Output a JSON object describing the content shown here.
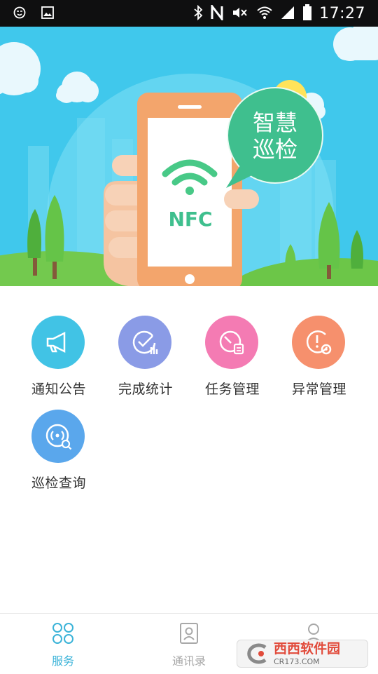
{
  "status_bar": {
    "time": "17:27",
    "icons": [
      "emoji-icon",
      "image-icon",
      "bluetooth-icon",
      "nfc-icon",
      "mute-icon",
      "wifi-icon",
      "signal-icon",
      "battery-icon"
    ]
  },
  "banner": {
    "nfc_text": "NFC",
    "bubble_line1": "智慧",
    "bubble_line2": "巡检",
    "colors": {
      "sky": "#3fc6ea",
      "phone": "#f3a56c",
      "bubble": "#3fbf8e",
      "wifi": "#48c987"
    }
  },
  "menu": {
    "items": [
      {
        "label": "通知公告",
        "icon": "megaphone-icon",
        "color": "#41c3e5"
      },
      {
        "label": "完成统计",
        "icon": "stats-check-icon",
        "color": "#8a9be6"
      },
      {
        "label": "任务管理",
        "icon": "task-icon",
        "color": "#f47bb3"
      },
      {
        "label": "异常管理",
        "icon": "alert-gear-icon",
        "color": "#f6906d"
      },
      {
        "label": "巡检查询",
        "icon": "nfc-search-icon",
        "color": "#5aa7ec"
      }
    ]
  },
  "tabbar": {
    "tabs": [
      {
        "label": "服务",
        "icon": "grid-icon",
        "active": true
      },
      {
        "label": "通讯录",
        "icon": "contacts-icon",
        "active": false
      },
      {
        "label": "",
        "icon": "profile-icon",
        "active": false
      }
    ],
    "active_color": "#3bb3d8",
    "inactive_color": "#a8a8a8"
  },
  "watermark": {
    "brand": "西西软件园",
    "url": "CR173.COM"
  }
}
